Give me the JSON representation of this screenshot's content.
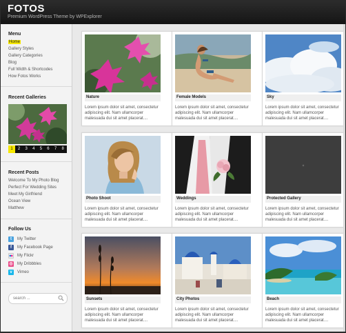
{
  "site": {
    "title": "FOTOS",
    "tagline": "Premium WordPress Theme by WPExplorer"
  },
  "sidebar": {
    "menu_heading": "Menu",
    "menu_items": [
      "Home",
      "Gallery Styles",
      "Gallery Categories",
      "Blog",
      "Full Width & Shortcodes",
      "How Fotos Works"
    ],
    "recent_galleries_heading": "Recent Galleries",
    "pager": [
      "1",
      "2",
      "3",
      "4",
      "5",
      "6",
      "7",
      "8"
    ],
    "pager_active": "1",
    "recent_posts_heading": "Recent Posts",
    "recent_posts": [
      "Welcome To My Photo Blog",
      "Perfect For Wedding Sites",
      "Meet My Girlfriend",
      "Ocean View",
      "Matthew"
    ],
    "follow_heading": "Follow Us",
    "social": [
      {
        "label": "My Twitter",
        "icon": "twitter-icon",
        "color": "#4aa3df",
        "glyph": "t"
      },
      {
        "label": "My Facebook Page",
        "icon": "facebook-icon",
        "color": "#3b5998",
        "glyph": "f"
      },
      {
        "label": "My Flickr",
        "icon": "flickr-icon",
        "color": "#e8e8e8",
        "glyph": ""
      },
      {
        "label": "My Dribbbles",
        "icon": "dribbble-icon",
        "color": "#ea4c89",
        "glyph": "◎"
      },
      {
        "label": "Vimeo",
        "icon": "vimeo-icon",
        "color": "#1ab7ea",
        "glyph": "v"
      }
    ],
    "search_placeholder": "search ..."
  },
  "gallery": {
    "excerpt": "Lorem ipsum dolor sit amet, consectetur adipiscing elit. Nam ullamcorper malesuada dui sit amet placerat....",
    "cards": [
      {
        "title": "Nature"
      },
      {
        "title": "Female Models"
      },
      {
        "title": "Sky"
      },
      {
        "title": "Photo Shoot"
      },
      {
        "title": "Weddings"
      },
      {
        "title": "Protected Gallery"
      },
      {
        "title": "Sunsets"
      },
      {
        "title": "City Photos"
      },
      {
        "title": "Beach"
      }
    ]
  },
  "colors": {
    "header": "#1c1c1c",
    "accent_yellow": "#f6e800",
    "page_bg": "#e9e9e9",
    "sidebar_bg": "#f3f3f3"
  }
}
